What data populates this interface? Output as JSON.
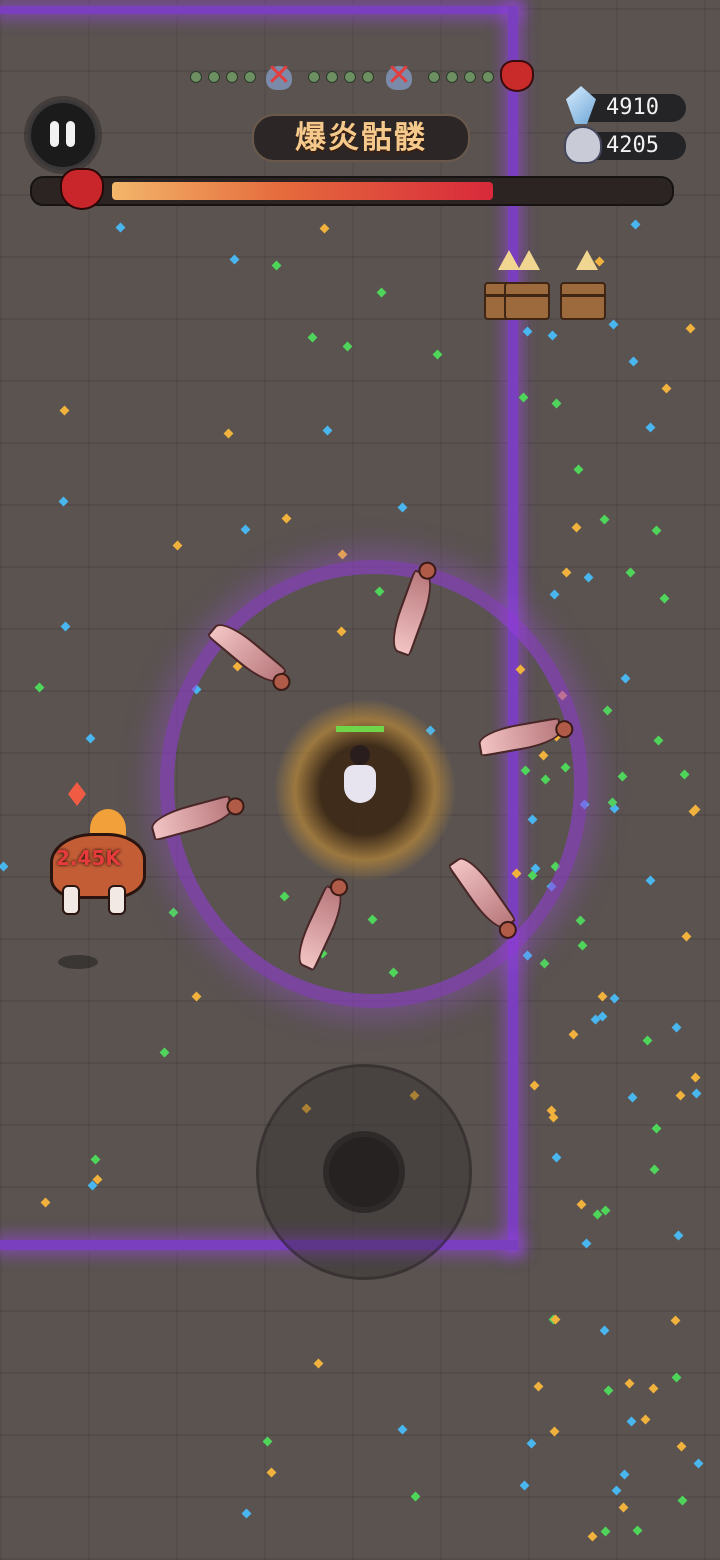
{
  "hud": {
    "boss_name": "爆炎骷髅",
    "boss_hp_fraction": 0.68,
    "currencies": [
      {
        "name": "crystal",
        "icon": "crystal-icon",
        "value": "4910"
      },
      {
        "name": "soul",
        "icon": "soul-icon",
        "value": "4205"
      }
    ],
    "wave_progress": {
      "stages_cleared_skulls": 2,
      "dots_per_segment": 4,
      "final_icon": "boss-demon-icon"
    }
  },
  "combat": {
    "damage_text": "2.45K",
    "player_hp_fraction": 1.0
  },
  "colors": {
    "wall": "#7a3fbf",
    "boss_bar_start": "#f3b66a",
    "boss_bar_end": "#d8293b",
    "title_text": "#f4c98b"
  }
}
